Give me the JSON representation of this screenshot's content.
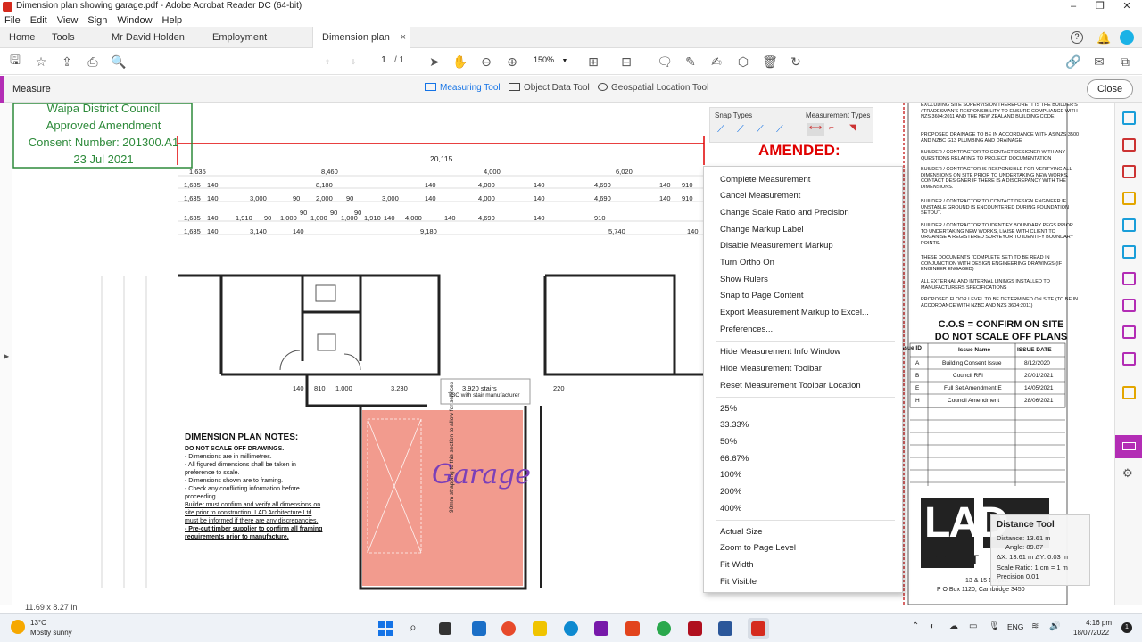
{
  "window": {
    "title": "Dimension plan showing garage.pdf - Adobe Acrobat Reader DC (64-bit)",
    "minimize": "–",
    "maximize": "❐",
    "close": "✕"
  },
  "menu": [
    "File",
    "Edit",
    "View",
    "Sign",
    "Window",
    "Help"
  ],
  "tabs": {
    "home": "Home",
    "tools": "Tools",
    "doc1": "Mr David Holden",
    "doc2": "Employment contra...",
    "doc3": "Dimension plan sh...",
    "close": "×"
  },
  "toolbar": {
    "page_current": "1",
    "page_total": "/ 1",
    "zoom": "150%"
  },
  "measure": {
    "label": "Measure",
    "measuring_tool": "Measuring Tool",
    "object_data_tool": "Object Data Tool",
    "geospatial_tool": "Geospatial Location Tool",
    "close": "Close"
  },
  "snap_panel": {
    "snap_types": "Snap Types",
    "measurement_types": "Measurement Types"
  },
  "context_menu": {
    "group1": [
      "Complete Measurement",
      "Cancel Measurement",
      "Change Scale Ratio and Precision",
      "Change Markup Label",
      "Disable Measurement Markup",
      "Turn Ortho On",
      "Show Rulers",
      "Snap to Page Content",
      "Export Measurement Markup to Excel...",
      "Preferences..."
    ],
    "group2": [
      "Hide Measurement Info Window",
      "Hide Measurement Toolbar",
      "Reset Measurement Toolbar Location"
    ],
    "group3": [
      "25%",
      "33.33%",
      "50%",
      "66.67%",
      "100%",
      "200%",
      "400%"
    ],
    "group4": [
      "Actual Size",
      "Zoom to Page Level",
      "Fit Width",
      "Fit Visible"
    ]
  },
  "distance_tool": {
    "title": "Distance Tool",
    "distance": "Distance: 13.61 m",
    "angle": "Angle: 89.87",
    "deltas": "ΔX: 13.61 m     ΔY: 0.03 m",
    "scale": "Scale Ratio: 1 cm = 1 m",
    "precision": "Precision      0.01"
  },
  "drawing": {
    "stamp": {
      "line1": "Waipa District Council",
      "line2": "Approved Amendment",
      "line3": "Consent Number: 201300.A1",
      "line4": "23 Jul 2021"
    },
    "measure_value": "20,115",
    "amended": "AMENDED:",
    "notes_title": "DIMENSION PLAN NOTES:",
    "notes": [
      "DO NOT SCALE OFF DRAWINGS.",
      "- Dimensions are in millimetres.",
      "- All figured dimensions shall be taken in",
      "preference to scale.",
      "- Dimensions shown are to framing.",
      "- Check any conflicting information before",
      "proceeding.",
      "Builder must confirm and verify all dimensions on",
      "site prior to construction. LAD Architecture Ltd",
      "must be informed if there are any discrepancies.",
      "- Pre-cut timber supplier to confirm all framing",
      "requirements prior to manufacture."
    ],
    "garage": "Garage",
    "stairs": "3,920 stairs",
    "stairs_note": "TBC with stair manufacturer",
    "strapping_note": "90mm strapping to this section to allow for services",
    "row1": [
      "1,635",
      "8,460",
      "4,000",
      "6,020"
    ],
    "row2": [
      "1,635",
      "140",
      "8,180",
      "140",
      "4,000",
      "140",
      "4,690",
      "140",
      "910"
    ],
    "row3": [
      "1,635",
      "140",
      "3,000",
      "90",
      "2,000",
      "90",
      "3,000",
      "140",
      "4,000",
      "140",
      "4,690",
      "140",
      "910"
    ],
    "row4": [
      "1,635",
      "140",
      "1,910",
      "90",
      "1,000",
      "90",
      "1,000",
      "90",
      "1,000",
      "90",
      "1,910",
      "140",
      "4,000",
      "140",
      "4,690",
      "140",
      "910"
    ],
    "row5": [
      "1,635",
      "140",
      "3,140",
      "140",
      "9,180",
      "5,740",
      "140"
    ],
    "mid_dims": [
      "140",
      "810",
      "1,000",
      "3,230",
      "220"
    ],
    "right_notes": [
      "EXCLUDING SITE SUPERVISION THEREFORE IT IS THE BUILDER'S / TRADESMAN'S RESPONSIBILITY TO ENSURE COMPLIANCE WITH NZS 3604:2011 AND THE NEW ZEALAND BUILDING CODE",
      "PROPOSED DRAINAGE TO BE IN ACCORDANCE WITH AS/NZS 3500 AND NZBC G13 PLUMBING AND DRAINAGE",
      "BUILDER / CONTRACTOR TO CONTACT DESIGNER WITH ANY QUESTIONS RELATING TO PROJECT DOCUMENTATION",
      "BUILDER / CONTRACTOR IS RESPONSIBLE FOR VERIFYING ALL DIMENSIONS ON SITE PRIOR TO UNDERTAKING NEW WORKS, CONTACT DESIGNER IF THERE IS A DISCREPANCY WITH THE DIMENSIONS.",
      "BUILDER / CONTRACTOR TO CONTACT DESIGN ENGINEER IF UNSTABLE GROUND IS ENCOUNTERED DURING FOUNDATION SETOUT.",
      "BUILDER / CONTRACTOR TO IDENTIFY BOUNDARY PEGS PRIOR TO UNDERTAKING NEW WORKS, LIAISE WITH CLIENT TO ORGANISE A REGISTERED SURVEYOR TO IDENTIFY BOUNDARY POINTS.",
      "THESE DOCUMENTS (COMPLETE SET) TO BE READ IN CONJUNCTION WITH DESIGN ENGINEERING DRAWINGS (IF ENGINEER ENGAGED)",
      "ALL EXTERNAL AND INTERNAL LININGS INSTALLED TO MANUFACTURERS SPECIFICATIONS",
      "PROPOSED FLOOR LEVEL TO BE DETERMINED ON SITE (TO BE IN ACCORDANCE WITH NZBC AND NZS 3604:2011)"
    ],
    "cos1": "C.O.S = CONFIRM ON SITE",
    "cos2": "DO NOT SCALE OFF PLANS",
    "rev_header": [
      "Issue ID",
      "Issue Name",
      "ISSUE DATE"
    ],
    "rev_rows": [
      [
        "A",
        "Building Consent Issue",
        "8/12/2020"
      ],
      [
        "B",
        "Council RFI",
        "20/01/2021"
      ],
      [
        "E",
        "Full Set Amendment E",
        "14/05/2021"
      ],
      [
        "H",
        "Council Amendment",
        "28/06/2021"
      ]
    ],
    "logo": "LAD",
    "archit": "ARCHIT",
    "address1": "13 & 15 Empire",
    "address2": "P O Box 1120, Cambridge 3450"
  },
  "status": {
    "page_size": "11.69 x 8.27 in"
  },
  "taskbar": {
    "temp": "13°C",
    "weather": "Mostly sunny",
    "lang": "ENG",
    "time": "4:16 pm",
    "date": "18/07/2022"
  },
  "colors": {
    "accent": "#b32db5",
    "blue": "#1473e6",
    "stamp_green": "#2d8a3a",
    "measure_red": "#e00000",
    "garage_fill": "#f08a7a"
  }
}
